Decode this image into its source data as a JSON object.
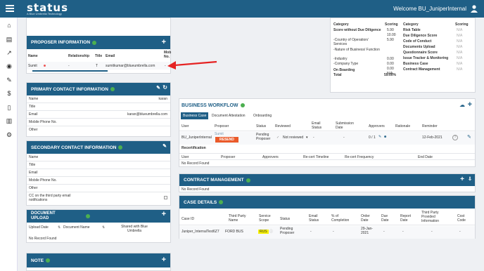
{
  "app": {
    "logo": "status",
    "logo_sub": "A Blue Umbrella Technology",
    "welcome": "Welcome BU_JuniperInternal"
  },
  "proposer": {
    "title": "PROPOSER INFORMATION",
    "cols": [
      "Name",
      "Relationship",
      "Title",
      "Email",
      "Mob No."
    ],
    "row": {
      "name": "Sumit",
      "relationship": "-",
      "title": "T",
      "email": "sumitkumar@blueumbrella.com",
      "mob": "-"
    }
  },
  "primary": {
    "title": "PRIMARY CONTACT INFORMATION",
    "rows": [
      {
        "label": "Name",
        "value": "karan"
      },
      {
        "label": "Title",
        "value": ""
      },
      {
        "label": "Email",
        "value": "karan@blueumbrella.com"
      },
      {
        "label": "Mobile Phone No.",
        "value": ""
      },
      {
        "label": "Other",
        "value": ""
      }
    ]
  },
  "secondary": {
    "title": "SECONDARY CONTACT INFORMATION",
    "rows": [
      "Name",
      "Title",
      "Email",
      "Mobile Phone No.",
      "Other"
    ],
    "cc_label": "CC on the third party email notifications"
  },
  "document": {
    "title": "DOCUMENT UPLOAD",
    "cols": [
      "Upload Date",
      "Document Name",
      "Shared with Blue Umbrella"
    ],
    "empty": "No Record Found"
  },
  "note": {
    "title": "NOTE"
  },
  "scoring": {
    "left_header": [
      "Category",
      "Scoring"
    ],
    "left": [
      {
        "label": "Score without Due Diligence",
        "value": "5.90"
      },
      {
        "label": "-",
        "value": "10.00"
      },
      {
        "label": "-Country of Operation/ Services",
        "value": "5.90"
      },
      {
        "label": "-Nature of Business/ Function",
        "value": "0.00"
      },
      {
        "label": "-Industry",
        "value": "0.00"
      },
      {
        "label": "-Company Type",
        "value": "0.00"
      },
      {
        "label": "On Boarding",
        "value": "N/A"
      },
      {
        "label": "Total",
        "value": "59.00%"
      }
    ],
    "right_header": [
      "Category",
      "Scoring"
    ],
    "right": [
      {
        "label": "Risk Table",
        "value": "N/A"
      },
      {
        "label": "Due Diligence Score",
        "value": "N/A"
      },
      {
        "label": "Code of Conduct",
        "value": "N/A"
      },
      {
        "label": "Documents Upload",
        "value": "N/A"
      },
      {
        "label": "Questionnaire Score",
        "value": "N/A"
      },
      {
        "label": "Issue Tracker & Monitoring",
        "value": "N/A"
      },
      {
        "label": "Business Case",
        "value": "N/A"
      },
      {
        "label": "Contract Management",
        "value": "N/A"
      }
    ]
  },
  "workflow": {
    "title": "BUSINESS WORKFLOW",
    "tabs": [
      "Business Case",
      "Document Attestation",
      "Onboarding"
    ],
    "cols": [
      "User",
      "Proposer",
      "Status",
      "Reviewed",
      "Email Status",
      "Submission Date",
      "Approvers",
      "Rationale",
      "Reminder"
    ],
    "row": {
      "user": "BU_JuniperInternal",
      "proposer": "Sumit",
      "resend": "RESEND",
      "status": "Pending Proposer",
      "reviewed": "Not reviewed",
      "email_status": "-",
      "submission": "-",
      "approvers": "0 / 1",
      "reminder": "12-Feb-2021"
    },
    "recert_title": "Recertification",
    "recert_cols": [
      "User",
      "Proposer",
      "Approvers",
      "Re-cert Timeline",
      "Re-cert Frequency",
      "End Date"
    ],
    "recert_empty": "No Record Found"
  },
  "contract": {
    "title": "CONTRACT MANAGEMENT",
    "empty": "No Record Found"
  },
  "cases": {
    "title": "CASE DETAILS",
    "cols": [
      "Case ID",
      "Third Party Name",
      "Service Scope",
      "Status",
      "Email Status",
      "% of Completion",
      "Order Date",
      "Due Date",
      "Report Date",
      "Third Party Provided Information",
      "Cost Code"
    ],
    "row": {
      "id": "Juniper_InternalTest6Z7",
      "tp": "FORD BUS",
      "scope": "RUS",
      "status": "Pending Proposer",
      "email": "-",
      "completion": "-",
      "order": "29-Jan-2021",
      "due": "-",
      "report": "-",
      "info": "-",
      "cost": "-"
    }
  }
}
